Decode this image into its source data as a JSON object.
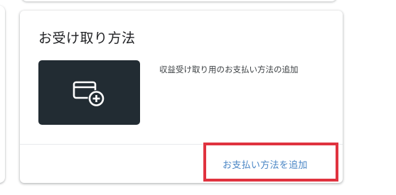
{
  "payment_card": {
    "title": "お受け取り方法",
    "tile_icon": "add-payment-card-icon",
    "description": "収益受け取り用のお支払い方法の追加",
    "add_link_label": "お支払い方法を追加"
  },
  "colors": {
    "tile_background": "#222c33",
    "link": "#4a86c5",
    "highlight": "#e0333f"
  }
}
